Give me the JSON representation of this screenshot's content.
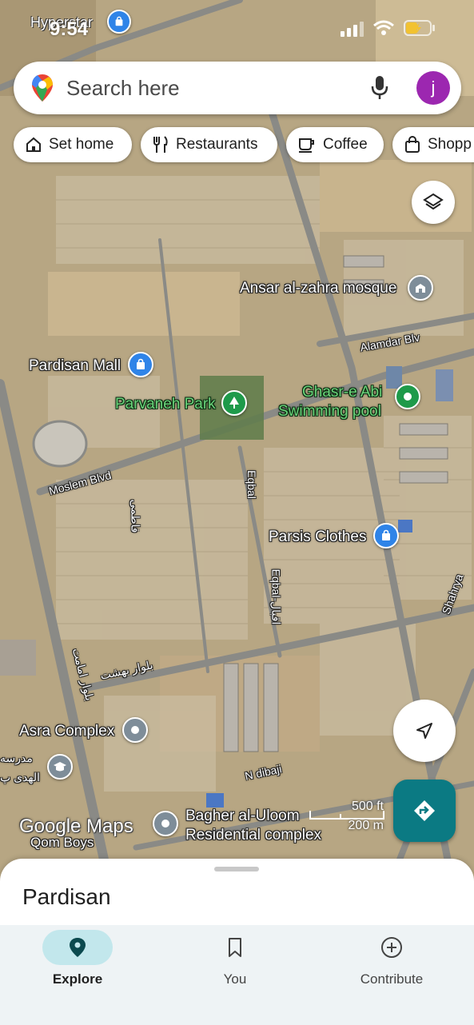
{
  "status_bar": {
    "time": "9:54"
  },
  "search": {
    "placeholder": "Search here",
    "avatar_letter": "j"
  },
  "chips": [
    {
      "label": "Set home",
      "icon": "home-icon"
    },
    {
      "label": "Restaurants",
      "icon": "fork-knife-icon"
    },
    {
      "label": "Coffee",
      "icon": "coffee-cup-icon"
    },
    {
      "label": "Shopp",
      "icon": "shopping-bag-icon"
    }
  ],
  "map_labels": {
    "hyperstar": "Hyperstar",
    "ansar": "Ansar al-zahra mosque",
    "alamdar": "Alamdar Blv",
    "pardisan_mall": "Pardisan Mall",
    "parvaneh_park": "Parvaneh Park",
    "ghasr_line1": "Ghasr-e Abi",
    "ghasr_line2": "Swimming pool",
    "moslem": "Moslem Blvd",
    "eqbal": "Eqbal",
    "parsis": "Parsis Clothes",
    "eqbal_arabic": "Eqbal-اقبال",
    "shahrya": "Shahrya",
    "imam_blvd": "بلوار امامت",
    "behesht_blvd": "بلوار بهشت",
    "asra": "Asra Complex",
    "school_line1": "مدرسه",
    "school_line2": "الهدی پ",
    "n_dibaji": "N dibaji",
    "bagher_line1": "Bagher al-Uloom",
    "bagher_line2": "Residential complex",
    "qom_boys": "Qom Boys",
    "fatemi": "فاطمی"
  },
  "scale": {
    "feet": "500 ft",
    "meters": "200 m"
  },
  "brand": "Google Maps",
  "sheet": {
    "title": "Pardisan"
  },
  "nav": [
    {
      "label": "Explore",
      "icon": "map-pin-icon",
      "active": true
    },
    {
      "label": "You",
      "icon": "bookmark-icon",
      "active": false
    },
    {
      "label": "Contribute",
      "icon": "add-circle-icon",
      "active": false
    }
  ],
  "colors": {
    "accent": "#0b7a83",
    "avatar": "#9c27b0",
    "nav_active": "#c2e7ec",
    "pin_blue": "#2f84e8",
    "pin_green": "#1e9a4a"
  }
}
